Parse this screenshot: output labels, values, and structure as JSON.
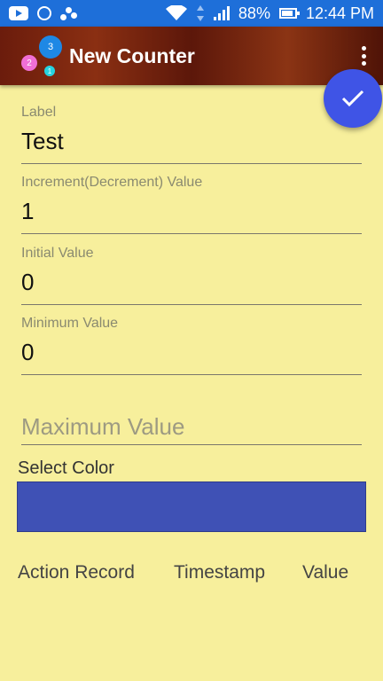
{
  "status_bar": {
    "battery": "88%",
    "time": "12:44 PM",
    "background": "#1e6fd9"
  },
  "app_bar": {
    "title": "New Counter",
    "logo_badges": [
      "3",
      "2",
      "1"
    ]
  },
  "form": {
    "label_field": {
      "label": "Label",
      "value": "Test"
    },
    "increment_field": {
      "label": "Increment(Decrement) Value",
      "value": "1"
    },
    "initial_field": {
      "label": "Initial Value",
      "value": "0"
    },
    "minimum_field": {
      "label": "Minimum Value",
      "value": "0"
    },
    "maximum_field": {
      "placeholder": "Maximum Value"
    },
    "select_color": {
      "label": "Select Color",
      "color": "#3f51b5"
    }
  },
  "record_table": {
    "headers": [
      "Action Record",
      "Timestamp",
      "Value"
    ]
  },
  "colors": {
    "background": "#f7ef9c",
    "fab": "#3f54e6",
    "app_bar": "#7a2610"
  }
}
